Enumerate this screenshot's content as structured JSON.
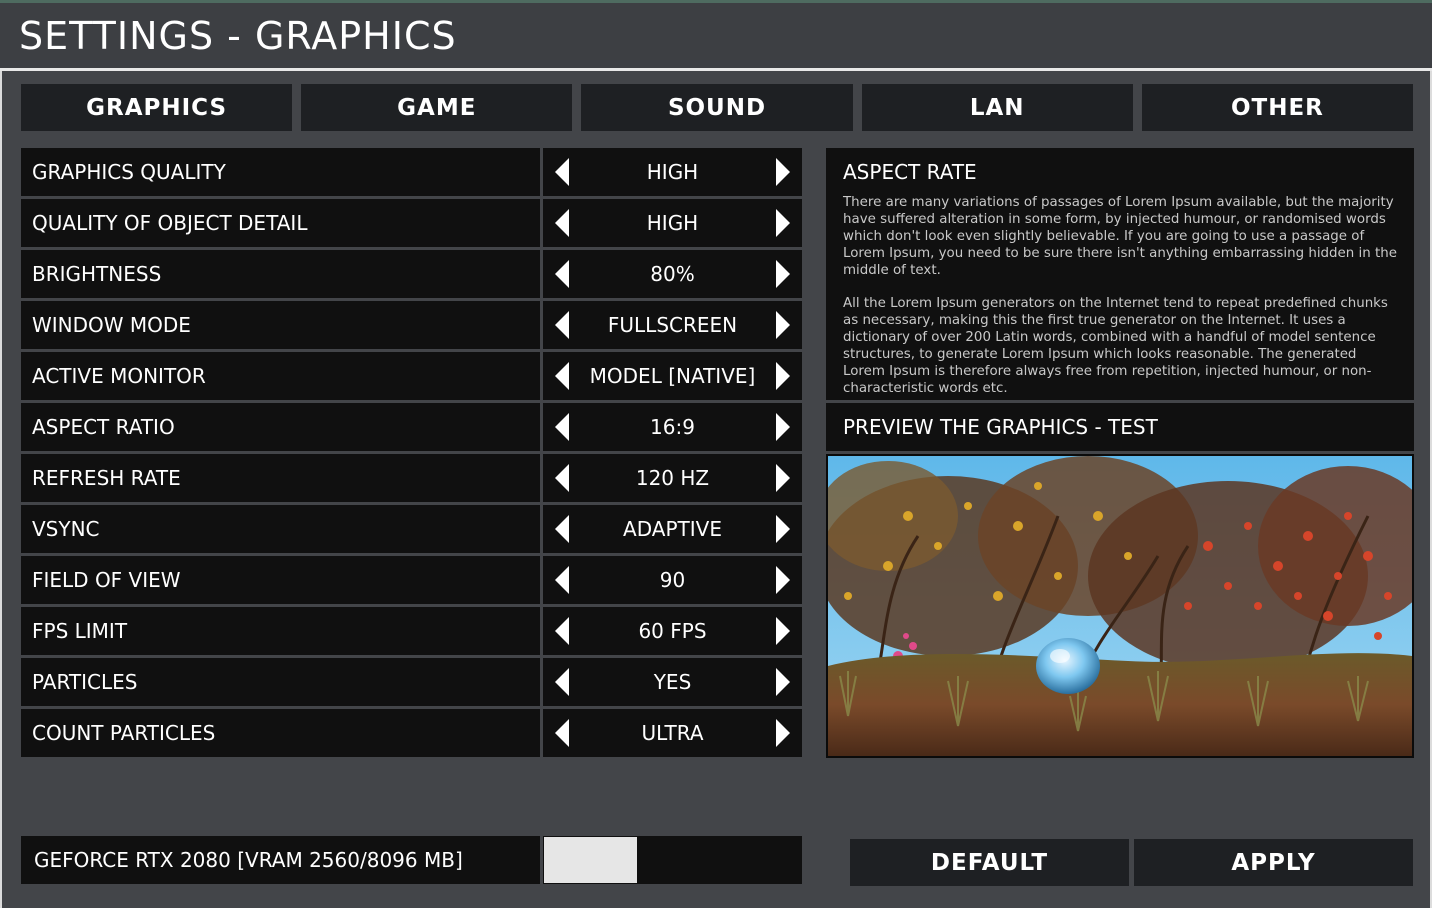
{
  "window": {
    "title": "SETTINGS - GRAPHICS"
  },
  "tabs": [
    {
      "label": "GRAPHICS",
      "active": true
    },
    {
      "label": "GAME",
      "active": false
    },
    {
      "label": "SOUND",
      "active": false
    },
    {
      "label": "LAN",
      "active": false
    },
    {
      "label": "OTHER",
      "active": false
    }
  ],
  "settings": [
    {
      "label": "GRAPHICS QUALITY",
      "value": "HIGH"
    },
    {
      "label": "QUALITY OF OBJECT DETAIL",
      "value": "HIGH"
    },
    {
      "label": "BRIGHTNESS",
      "value": "80%"
    },
    {
      "label": "WINDOW MODE",
      "value": "FULLSCREEN"
    },
    {
      "label": "ACTIVE MONITOR",
      "value": "MODEL [NATIVE]"
    },
    {
      "label": "ASPECT RATIO",
      "value": "16:9"
    },
    {
      "label": "REFRESH RATE",
      "value": "120 HZ"
    },
    {
      "label": "VSYNC",
      "value": "ADAPTIVE"
    },
    {
      "label": "FIELD OF VIEW",
      "value": "90"
    },
    {
      "label": "FPS LIMIT",
      "value": "60 FPS"
    },
    {
      "label": "PARTICLES",
      "value": "YES"
    },
    {
      "label": "COUNT PARTICLES",
      "value": "ULTRA"
    }
  ],
  "info": {
    "title": "ASPECT RATE",
    "paragraphs": [
      "There are many variations of passages of Lorem Ipsum available, but the majority have suffered alteration in some form, by injected humour, or randomised words which don't look even slightly believable. If you are going to use a passage of Lorem Ipsum, you need to be sure there isn't anything embarrassing hidden in the middle of text.",
      "All the Lorem Ipsum generators on the Internet tend to repeat predefined chunks as necessary, making this the first true generator on the Internet. It uses a dictionary of over 200 Latin words, combined with a handful of model sentence structures, to generate Lorem Ipsum which looks reasonable. The generated Lorem Ipsum is therefore always free from repetition, injected humour, or non-characteristic words etc."
    ]
  },
  "preview": {
    "title": "PREVIEW THE GRAPHICS - TEST",
    "image": "forest-scene-preview"
  },
  "gpu": {
    "label": "GEFORCE RTX 2080 [VRAM 2560/8096 MB]",
    "vram_fraction": 0.36
  },
  "buttons": {
    "default_label": "DEFAULT",
    "apply_label": "APPLY"
  },
  "icons": {
    "prev": "arrow-left-icon",
    "next": "arrow-right-icon"
  },
  "colors": {
    "background": "#434549",
    "panel": "#101010",
    "tab": "#1e2023",
    "text": "#ffffff"
  }
}
